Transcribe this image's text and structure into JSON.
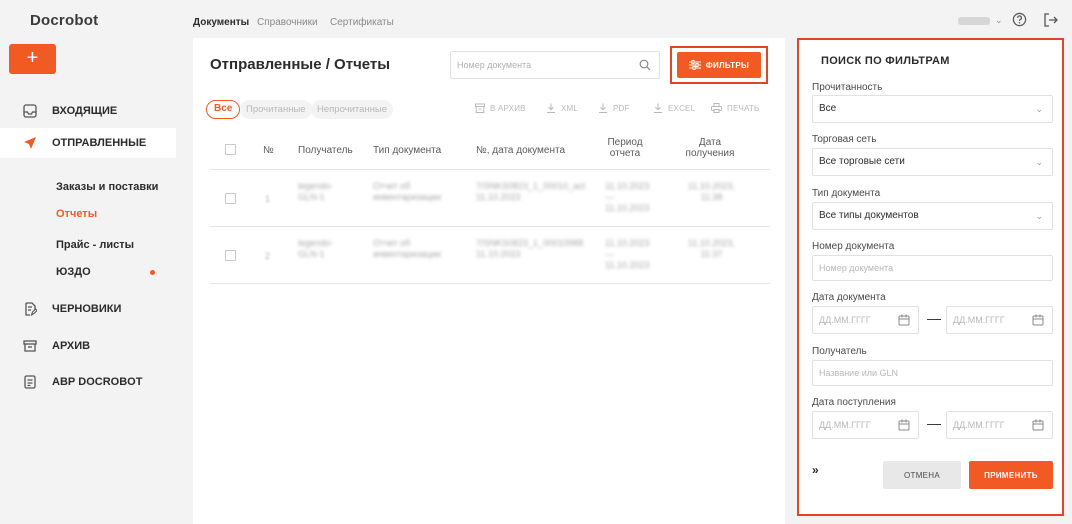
{
  "app": {
    "logo": "Docrobot"
  },
  "sidebar": {
    "new_button": "+",
    "items": [
      {
        "label": "ВХОДЯЩИЕ",
        "icon": "inbox-icon"
      },
      {
        "label": "ОТПРАВЛЕННЫЕ",
        "icon": "send-icon",
        "active": true
      },
      {
        "label": "ЧЕРНОВИКИ",
        "icon": "draft-icon"
      },
      {
        "label": "АРХИВ",
        "icon": "archive-icon"
      },
      {
        "label": "АВР DOCROBOT",
        "icon": "document-icon"
      }
    ],
    "sub_items": [
      {
        "label": "Заказы и поставки"
      },
      {
        "label": "Отчеты",
        "active": true
      },
      {
        "label": "Прайс - листы"
      },
      {
        "label": "ЮЗДО",
        "has_dot": true
      }
    ]
  },
  "topbar": {
    "tabs": [
      {
        "label": "Документы",
        "active": true
      },
      {
        "label": "Справочники"
      },
      {
        "label": "Сертификаты"
      }
    ]
  },
  "main": {
    "title": "Отправленные / Отчеты",
    "search_placeholder": "Номер документа",
    "filters_label": "ФИЛЬТРЫ",
    "chips": [
      "Все",
      "Прочитанные",
      "Непрочитанные"
    ],
    "actions": [
      "В АРХИВ",
      "XML",
      "PDF",
      "EXCEL",
      "ПЕЧАТЬ"
    ],
    "columns": {
      "num": "№",
      "recipient": "Получатель",
      "doc_type": "Тип документа",
      "doc_no_date": "№, дата документа",
      "period_1": "Период",
      "period_2": "отчета",
      "received_1": "Дата",
      "received_2": "получения"
    },
    "rows": [
      {
        "num": "1",
        "recipient_1": "legendo-",
        "recipient_2": "GLN-1",
        "type_1": "Отчет об",
        "type_2": "инвентаризации",
        "docno_1": "7/SNKS0823_1_00010_act",
        "docno_2": "11.10.2023",
        "period_1": "11.10.2023",
        "period_2": "—",
        "period_3": "11.10.2023",
        "received_1": "11.10.2023,",
        "received_2": "11:38"
      },
      {
        "num": "2",
        "recipient_1": "legendo-",
        "recipient_2": "GLN-1",
        "type_1": "Отчет об",
        "type_2": "инвентаризации",
        "docno_1": "7/SNKS0823_1_00010988",
        "docno_2": "11.10.2023",
        "period_1": "11.10.2023",
        "period_2": "—",
        "period_3": "11.10.2023",
        "received_1": "11.10.2023,",
        "received_2": "11:37"
      }
    ]
  },
  "filter_panel": {
    "title": "ПОИСК ПО ФИЛЬТРАМ",
    "read_label": "Прочитанность",
    "read_value": "Все",
    "chain_label": "Торговая сеть",
    "chain_value": "Все торговые сети",
    "doctype_label": "Тип документа",
    "doctype_value": "Все типы документов",
    "docno_label": "Номер документа",
    "docno_placeholder": "Номер документа",
    "docdate_label": "Дата документа",
    "date_placeholder": "ДД.ММ.ГГГГ",
    "recipient_label": "Получатель",
    "recipient_placeholder": "Название или GLN",
    "received_label": "Дата поступления",
    "dash": "—",
    "collapse": "»",
    "cancel": "ОТМЕНА",
    "apply": "ПРИМЕНИТЬ"
  },
  "colors": {
    "accent": "#f15a22",
    "highlight": "#e0452a"
  }
}
